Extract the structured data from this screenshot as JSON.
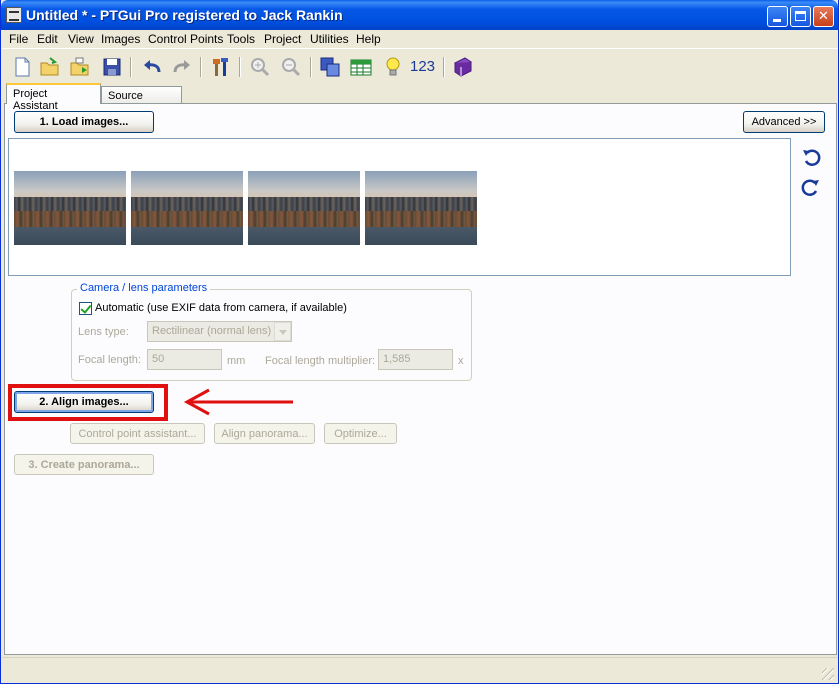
{
  "window": {
    "title": "Untitled * - PTGui Pro registered to Jack Rankin",
    "minimize": "_",
    "maximize": "□",
    "close": "✕"
  },
  "menu": [
    "File",
    "Edit",
    "View",
    "Images",
    "Control Points",
    "Tools",
    "Project",
    "Utilities",
    "Help"
  ],
  "toolbar": {
    "icons": [
      "new-file-icon",
      "open-folder-icon",
      "open-recent-icon",
      "save-icon",
      "undo-icon",
      "redo-icon",
      "tools-hammer-icon",
      "zoom-in-icon",
      "zoom-out-icon",
      "panorama-editor-icon",
      "spreadsheet-icon",
      "lightbulb-icon",
      "numbers-icon",
      "help-book-icon"
    ],
    "numbers_label": "123"
  },
  "tabs": [
    {
      "label": "Project Assistant",
      "active": true
    },
    {
      "label": "Source Images",
      "active": false
    }
  ],
  "buttons": {
    "load_images": "1. Load images...",
    "advanced": "Advanced >>",
    "align_images": "2. Align images...",
    "control_point_assistant": "Control point assistant...",
    "align_panorama": "Align panorama...",
    "optimize": "Optimize...",
    "create_panorama": "3. Create panorama..."
  },
  "images": {
    "count": 4
  },
  "camera": {
    "legend": "Camera / lens parameters",
    "automatic_label": "Automatic (use EXIF data from camera, if available)",
    "automatic_checked": true,
    "lens_type_label": "Lens type:",
    "lens_type_value": "Rectilinear (normal lens)",
    "focal_length_label": "Focal length:",
    "focal_length_value": "50",
    "focal_length_unit": "mm",
    "multiplier_label": "Focal length multiplier:",
    "multiplier_value": "1,585",
    "multiplier_unit": "x"
  },
  "colors": {
    "highlight": "#e01010",
    "arrow": "#e01010"
  }
}
